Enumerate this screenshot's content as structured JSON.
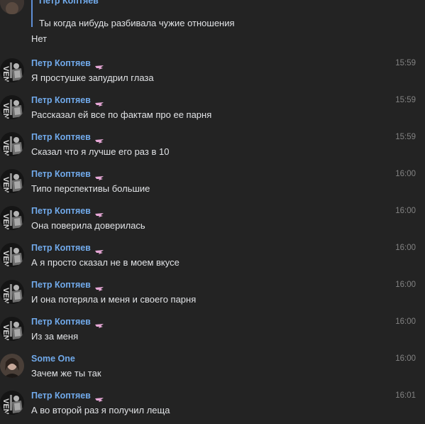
{
  "top_message": {
    "reply": {
      "author": "Петр Коптяев",
      "text": "Ты когда нибудь разбивала чужие отношения"
    },
    "text": "Нет"
  },
  "messages": [
    {
      "author": "Петр Коптяев",
      "avatar": "petr",
      "time": "15:59",
      "text": "Я простушке запудрил глаза"
    },
    {
      "author": "Петр Коптяев",
      "avatar": "petr",
      "time": "15:59",
      "text": "Рассказал ей все по фактам про ее парня"
    },
    {
      "author": "Петр Коптяев",
      "avatar": "petr",
      "time": "15:59",
      "text": "Сказал что я лучше его раз в 10"
    },
    {
      "author": "Петр Коптяев",
      "avatar": "petr",
      "time": "16:00",
      "text": "Типо перспективы большие"
    },
    {
      "author": "Петр Коптяев",
      "avatar": "petr",
      "time": "16:00",
      "text": "Она поверила доверилась"
    },
    {
      "author": "Петр Коптяев",
      "avatar": "petr",
      "time": "16:00",
      "text": "А я просто сказал не в моем вкусе"
    },
    {
      "author": "Петр Коптяев",
      "avatar": "petr",
      "time": "16:00",
      "text": "И она потеряла и меня и своего парня"
    },
    {
      "author": "Петр Коптяев",
      "avatar": "petr",
      "time": "16:00",
      "text": "Из за меня"
    },
    {
      "author": "Some One",
      "avatar": "someone",
      "time": "16:00",
      "text": "Зачем же ты так"
    },
    {
      "author": "Петр Коптяев",
      "avatar": "petr",
      "time": "16:01",
      "text": "А во второй раз я получил леща"
    }
  ],
  "colors": {
    "background": "#232323",
    "author": "#71aaeb",
    "text": "#e1e3e6",
    "time": "#828282",
    "badge": "#e6a7d6"
  },
  "icons": {
    "badge": "wing-badge-icon"
  }
}
